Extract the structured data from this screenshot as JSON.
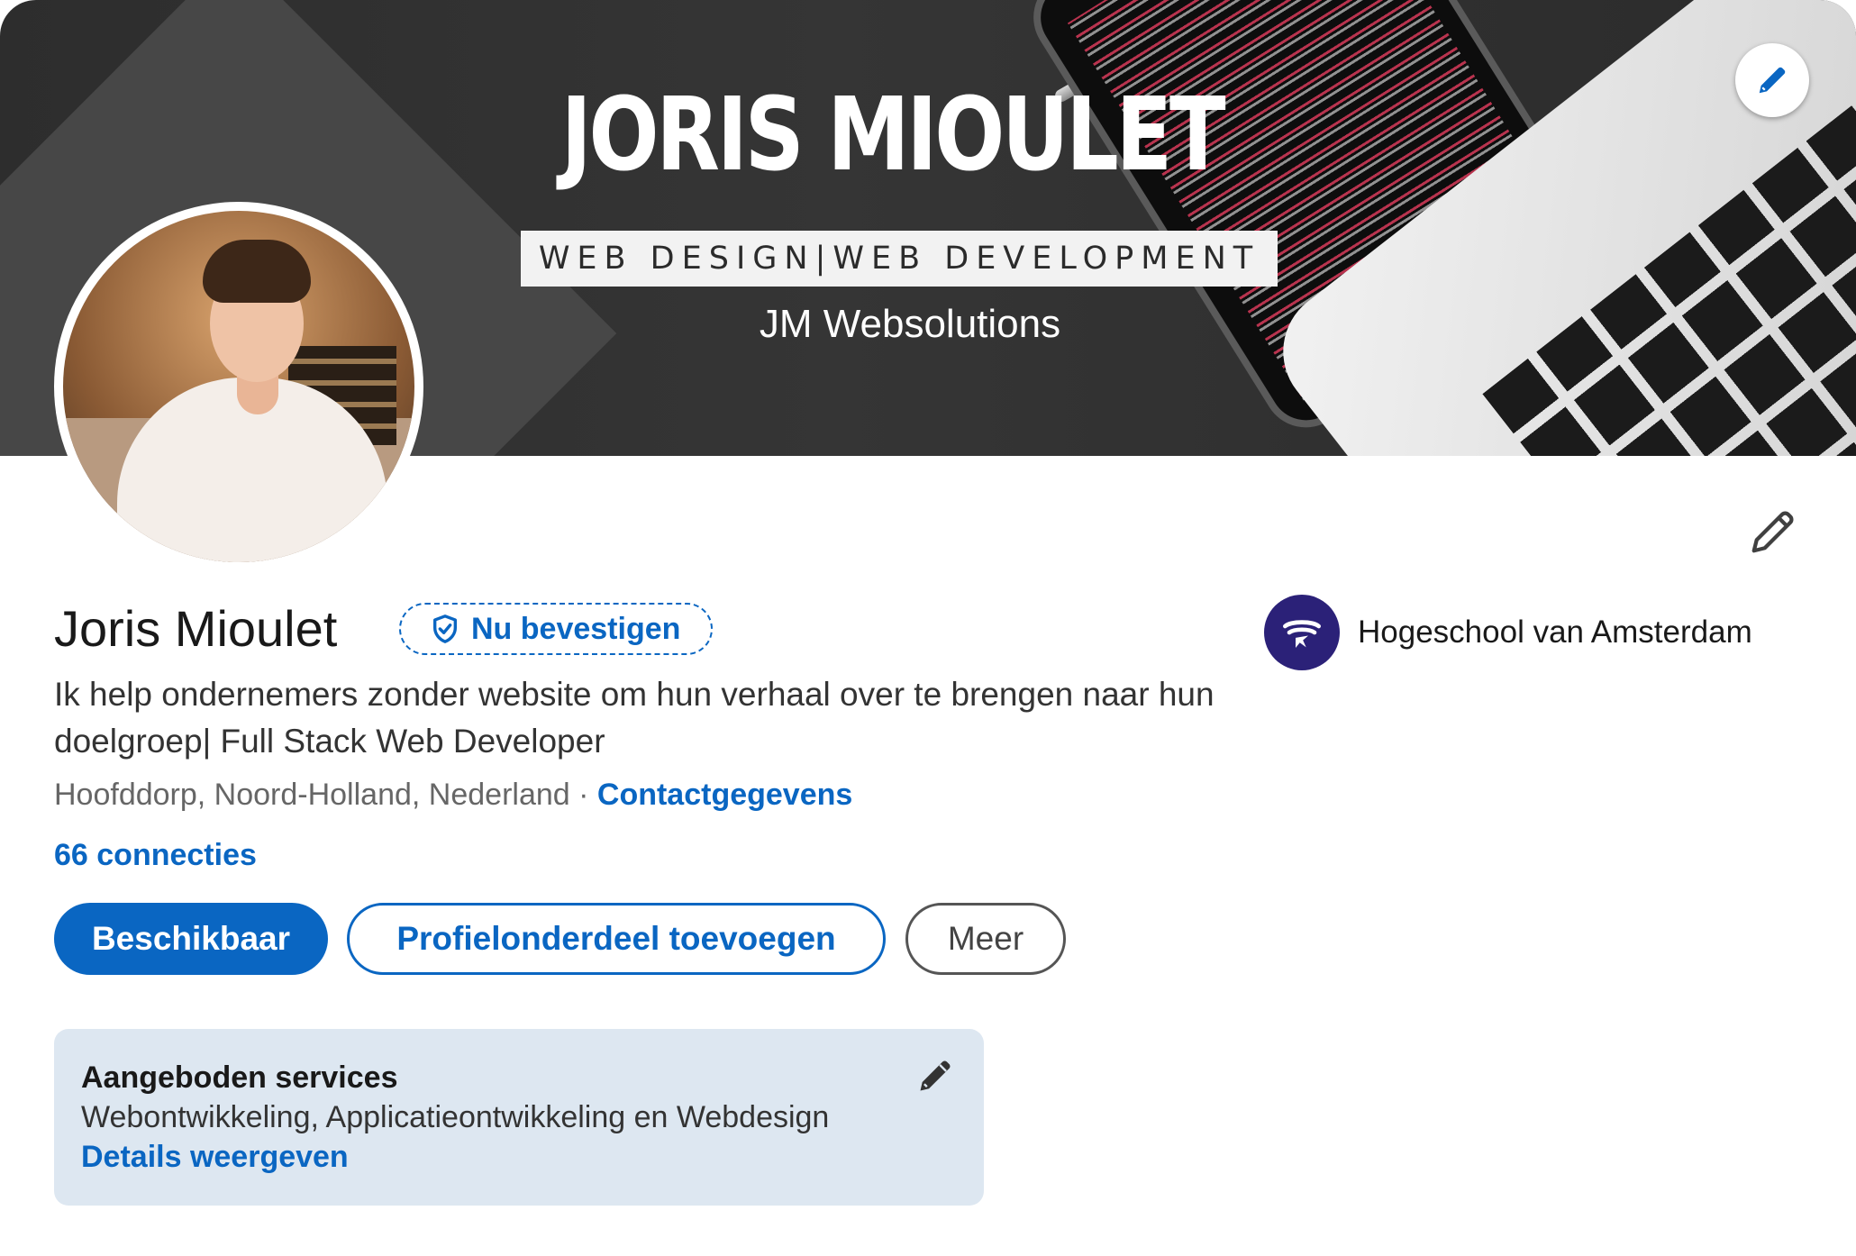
{
  "banner": {
    "title": "JORIS MIOULET",
    "tagline": "WEB DESIGN|WEB DEVELOPMENT",
    "company": "JM Websolutions"
  },
  "profile": {
    "name": "Joris Mioulet",
    "verify_label": "Nu bevestigen",
    "headline": "Ik help ondernemers zonder website om hun verhaal over te brengen naar hun doelgroep| Full Stack Web Developer",
    "location": "Hoofddorp, Noord-Holland, Nederland",
    "separator": " · ",
    "contact_label": "Contactgegevens",
    "connections": "66 connecties"
  },
  "actions": {
    "primary": "Beschikbaar",
    "add_section": "Profielonderdeel toevoegen",
    "more": "Meer"
  },
  "education": {
    "school": "Hogeschool van Amsterdam"
  },
  "services": {
    "title": "Aangeboden services",
    "list": "Webontwikkeling, Applicatieontwikkeling en Webdesign",
    "details_link": "Details weergeven"
  },
  "icons": {
    "banner_edit": "pencil-icon",
    "intro_edit": "pencil-icon",
    "verify": "shield-check-icon",
    "services_edit": "pencil-icon",
    "school_logo": "hva-logo"
  },
  "colors": {
    "accent": "#0a66c2",
    "services_bg": "#dde7f1",
    "school_logo_bg": "#2b2178"
  }
}
